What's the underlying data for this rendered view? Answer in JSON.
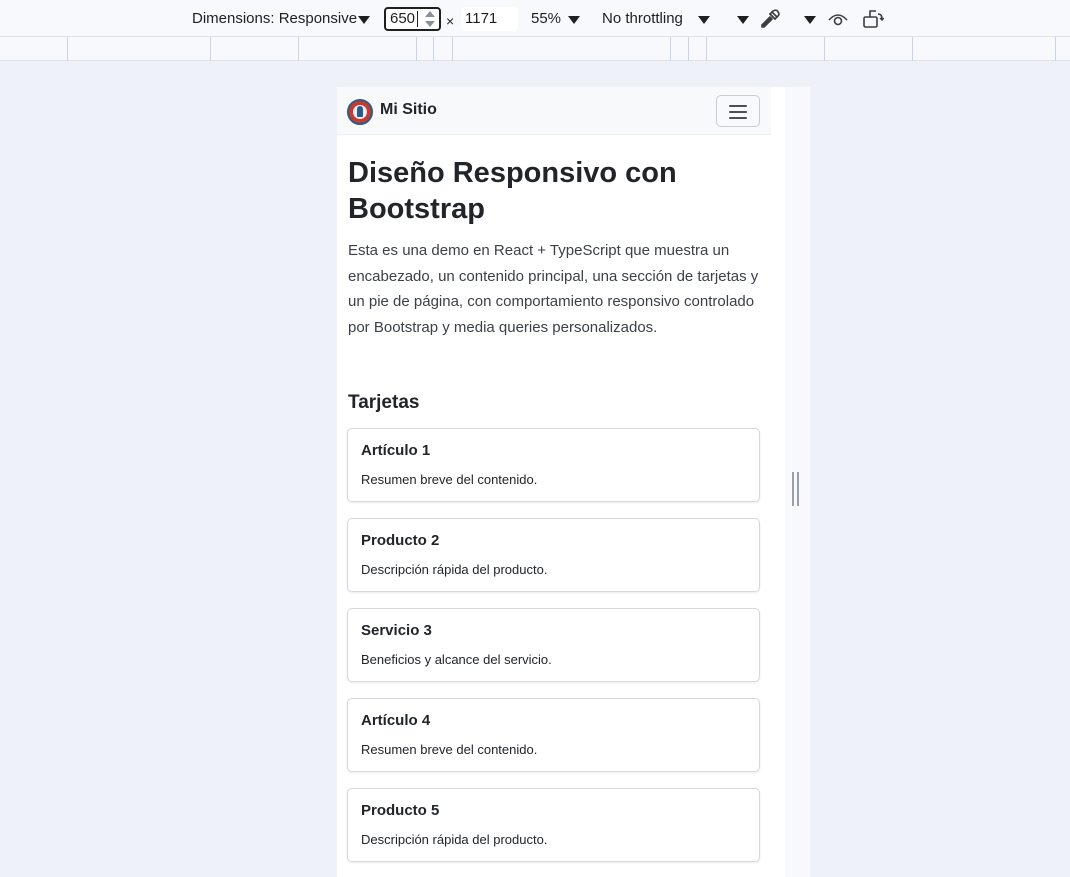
{
  "devtools": {
    "dimensions_label": "Dimensions: Responsive",
    "width_value": "650",
    "times_symbol": "×",
    "height_value": "1171",
    "zoom_label": "55%",
    "throttling_label": "No throttling",
    "icons": [
      "eyedropper-icon",
      "eye-icon",
      "rotate-icon"
    ]
  },
  "site": {
    "brand": "Mi Sitio",
    "title": "Diseño Responsivo con Bootstrap",
    "lead": "Esta es una demo en React + TypeScript que muestra un encabezado, un contenido principal, una sección de tarjetas y un pie de página, con comportamiento responsivo controlado por Bootstrap y media queries personalizados.",
    "cards_heading": "Tarjetas",
    "cards": [
      {
        "title": "Artículo 1",
        "text": "Resumen breve del contenido."
      },
      {
        "title": "Producto 2",
        "text": "Descripción rápida del producto."
      },
      {
        "title": "Servicio 3",
        "text": "Beneficios y alcance del servicio."
      },
      {
        "title": "Artículo 4",
        "text": "Resumen breve del contenido."
      },
      {
        "title": "Producto 5",
        "text": "Descripción rápida del producto."
      }
    ]
  },
  "colors": {
    "devtools_bg": "#f7f9fd",
    "page_bg": "#eef1f8",
    "navbar_bg": "#f8f9fa",
    "text": "#212529"
  }
}
